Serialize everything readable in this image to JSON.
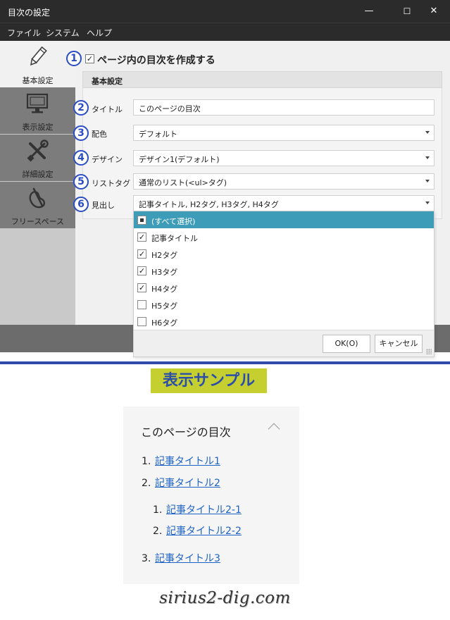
{
  "window": {
    "title": "目次の設定",
    "min": "—",
    "max": "☐",
    "close": "✕"
  },
  "menu": [
    "ファイル",
    "システム",
    "ヘルプ"
  ],
  "nav": [
    {
      "label": "基本設定",
      "icon": "pencil-icon"
    },
    {
      "label": "表示設定",
      "icon": "monitor-icon"
    },
    {
      "label": "詳細設定",
      "icon": "tools-icon"
    },
    {
      "label": "フリースペース",
      "icon": "free-space-icon"
    }
  ],
  "markers": [
    "1",
    "2",
    "3",
    "4",
    "5",
    "6"
  ],
  "create_toc": {
    "label": "ページ内の目次を作成する",
    "checked": true,
    "mark": "✓"
  },
  "section": {
    "title": "基本設定"
  },
  "fields": {
    "title": {
      "label": "タイトル",
      "value": "このページの目次"
    },
    "color": {
      "label": "配色",
      "value": "デフォルト"
    },
    "design": {
      "label": "デザイン",
      "value": "デザイン1(デフォルト)"
    },
    "list_tag": {
      "label": "リストタグ",
      "value": "通常のリスト(<ul>タグ)"
    },
    "headings": {
      "label": "見出し",
      "value": "記事タイトル, H2タグ, H3タグ, H4タグ"
    }
  },
  "dropdown": {
    "items": [
      {
        "label": "(すべて選択)",
        "state": "partial"
      },
      {
        "label": "記事タイトル",
        "state": "checked"
      },
      {
        "label": "H2タグ",
        "state": "checked"
      },
      {
        "label": "H3タグ",
        "state": "checked"
      },
      {
        "label": "H4タグ",
        "state": "checked"
      },
      {
        "label": "H5タグ",
        "state": "unchecked"
      },
      {
        "label": "H6タグ",
        "state": "unchecked"
      }
    ],
    "ok": "OK(O)",
    "cancel": "キャンセル"
  },
  "sample": {
    "heading": "表示サンプル",
    "toc_title": "このページの目次",
    "items": [
      {
        "num": "1.",
        "text": "記事タイトル1",
        "level": 1
      },
      {
        "num": "2.",
        "text": "記事タイトル2",
        "level": 1
      },
      {
        "num": "1.",
        "text": "記事タイトル2-1",
        "level": 2
      },
      {
        "num": "2.",
        "text": "記事タイトル2-2",
        "level": 2
      },
      {
        "num": "3.",
        "text": "記事タイトル3",
        "level": 1
      }
    ]
  },
  "watermark": "sirius2-dig.com",
  "colors": {
    "marker": "#2a4cc4",
    "highlight": "#3d9db8",
    "link": "#1d62c4",
    "sample_bg": "#c5cf2f",
    "separator": "#2f4aa8"
  }
}
